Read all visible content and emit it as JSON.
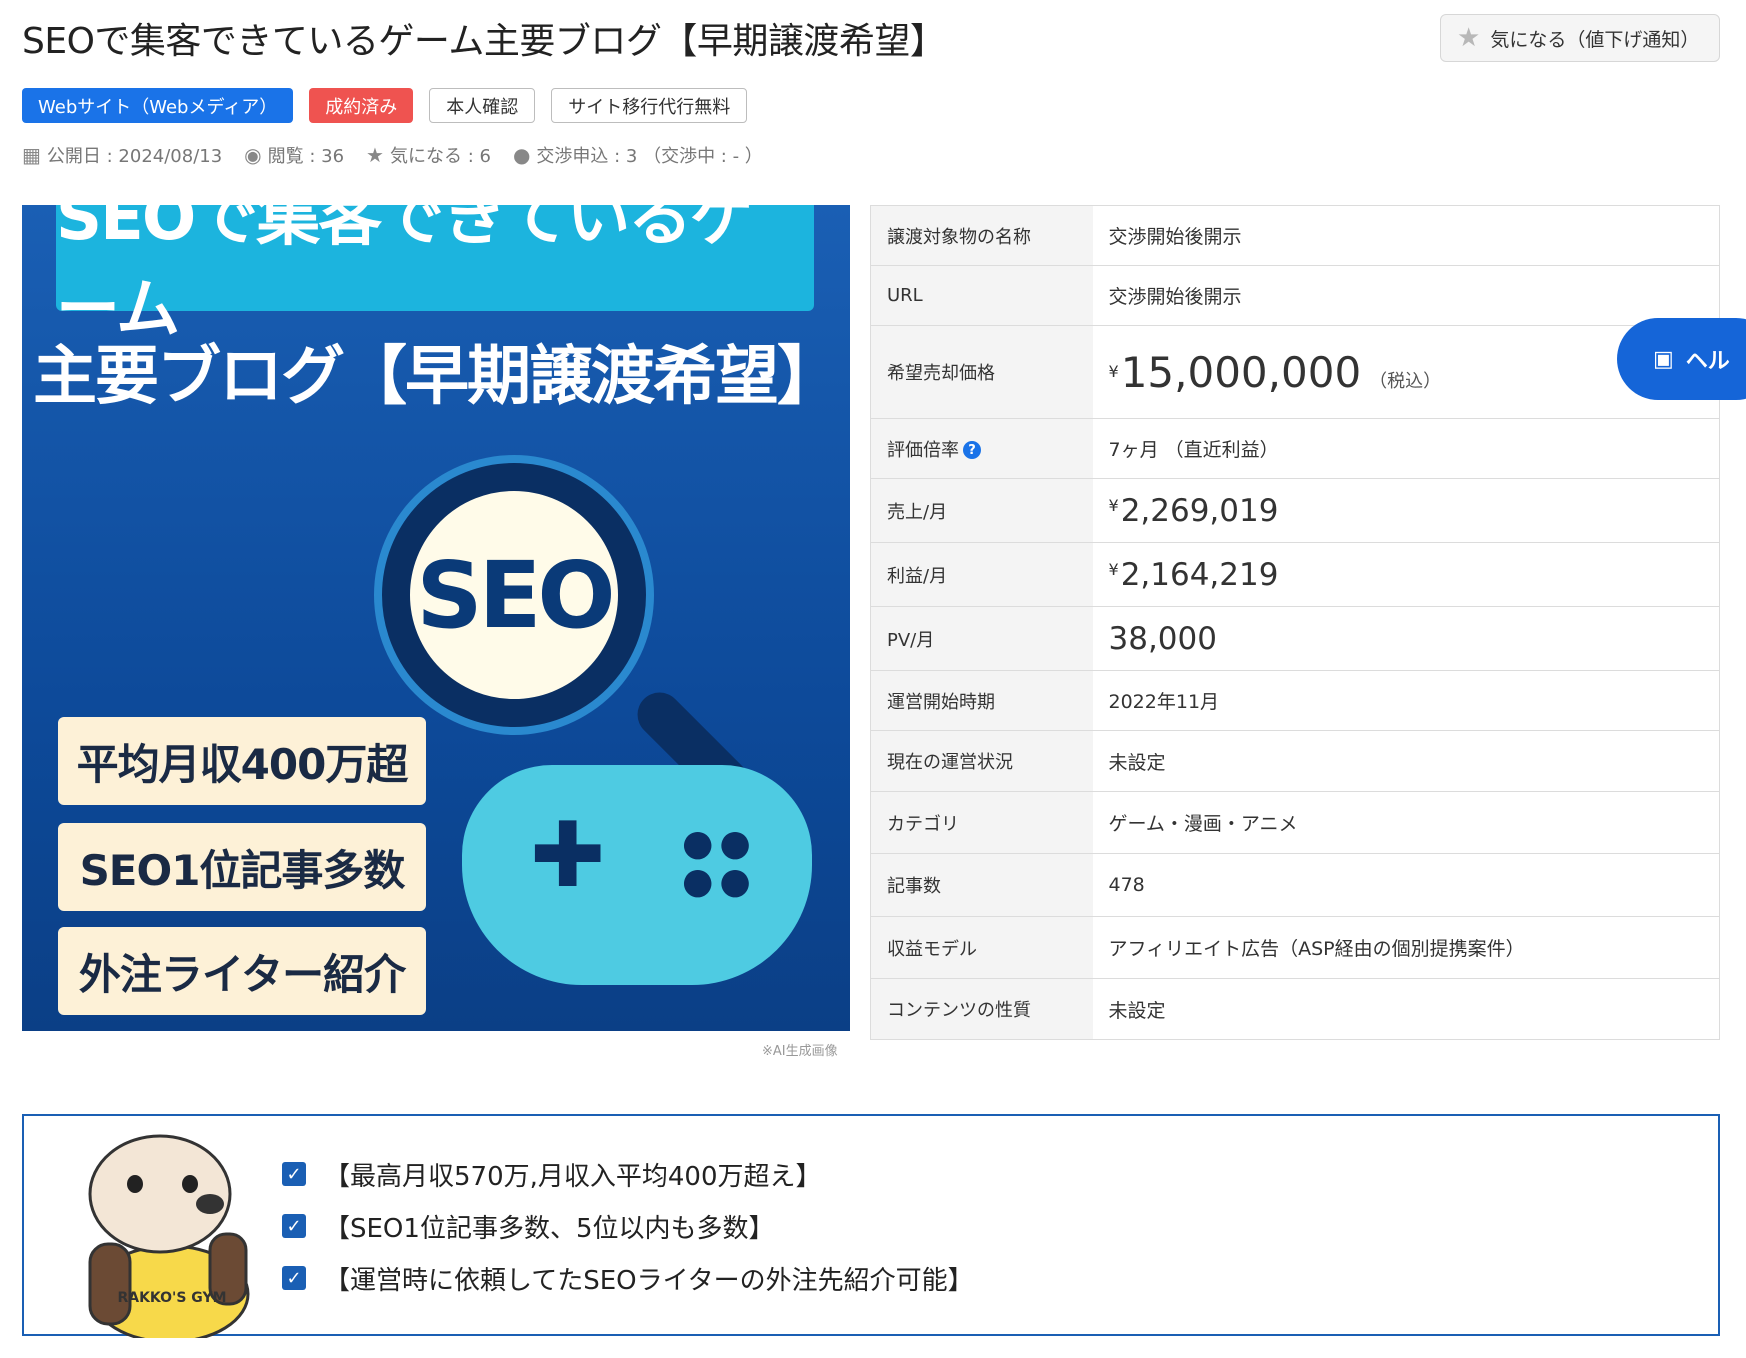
{
  "header": {
    "title": "SEOで集客できているゲーム主要ブログ【早期譲渡希望】",
    "fav_button": "気になる（値下げ通知）"
  },
  "tags": [
    {
      "label": "Webサイト（Webメディア）",
      "style": "blue"
    },
    {
      "label": "成約済み",
      "style": "red"
    },
    {
      "label": "本人確認",
      "style": "outline"
    },
    {
      "label": "サイト移行代行無料",
      "style": "outline"
    }
  ],
  "meta": {
    "published": "公開日 : 2024/08/13",
    "views": "閲覧 : 36",
    "favorites": "気になる : 6",
    "negotiations": "交渉申込 : 3 （交渉中 : - ）"
  },
  "hero": {
    "band_text": "SEOで集客できているゲーム",
    "sub_text": "主要ブログ【早期譲渡希望】",
    "lens_text": "SEO",
    "box1": "平均月収400万超",
    "box2": "SEO1位記事多数",
    "box3": "外注ライター紹介",
    "ai_note": "※AI生成画像",
    "colors": {
      "bg": "#1a5fb4",
      "band": "#1cb4de",
      "box": "#fdf1d7"
    }
  },
  "info": {
    "name_label": "譲渡対象物の名称",
    "name_value": "交渉開始後開示",
    "url_label": "URL",
    "url_value": "交渉開始後開示",
    "price_label": "希望売却価格",
    "price_currency": "¥",
    "price_value": "15,000,000",
    "price_note": "（税込）",
    "multiple_label": "評価倍率",
    "multiple_help": "?",
    "multiple_value": "7ヶ月 （直近利益）",
    "sales_label": "売上/月",
    "sales_currency": "¥",
    "sales_value": "2,269,019",
    "profit_label": "利益/月",
    "profit_currency": "¥",
    "profit_value": "2,164,219",
    "pv_label": "PV/月",
    "pv_value": "38,000",
    "start_label": "運営開始時期",
    "start_value": "2022年11月",
    "status_label": "現在の運営状況",
    "status_value": "未設定",
    "category_label": "カテゴリ",
    "category_value": "ゲーム・漫画・アニメ",
    "articles_label": "記事数",
    "articles_value": "478",
    "revenue_label": "収益モデル",
    "revenue_value": "アフィリエイト広告（ASP経由の個別提携案件）",
    "content_label": "コンテンツの性質",
    "content_value": "未設定"
  },
  "help_button": "ヘル",
  "points": {
    "mascot_text": "RAKKO'S GYM",
    "items": [
      "【最高月収570万,月収入平均400万超え】",
      "【SEO1位記事多数、5位以内も多数】",
      "【運営時に依頼してたSEOライターの外注先紹介可能】"
    ],
    "check_color": "#1a5fb4"
  }
}
